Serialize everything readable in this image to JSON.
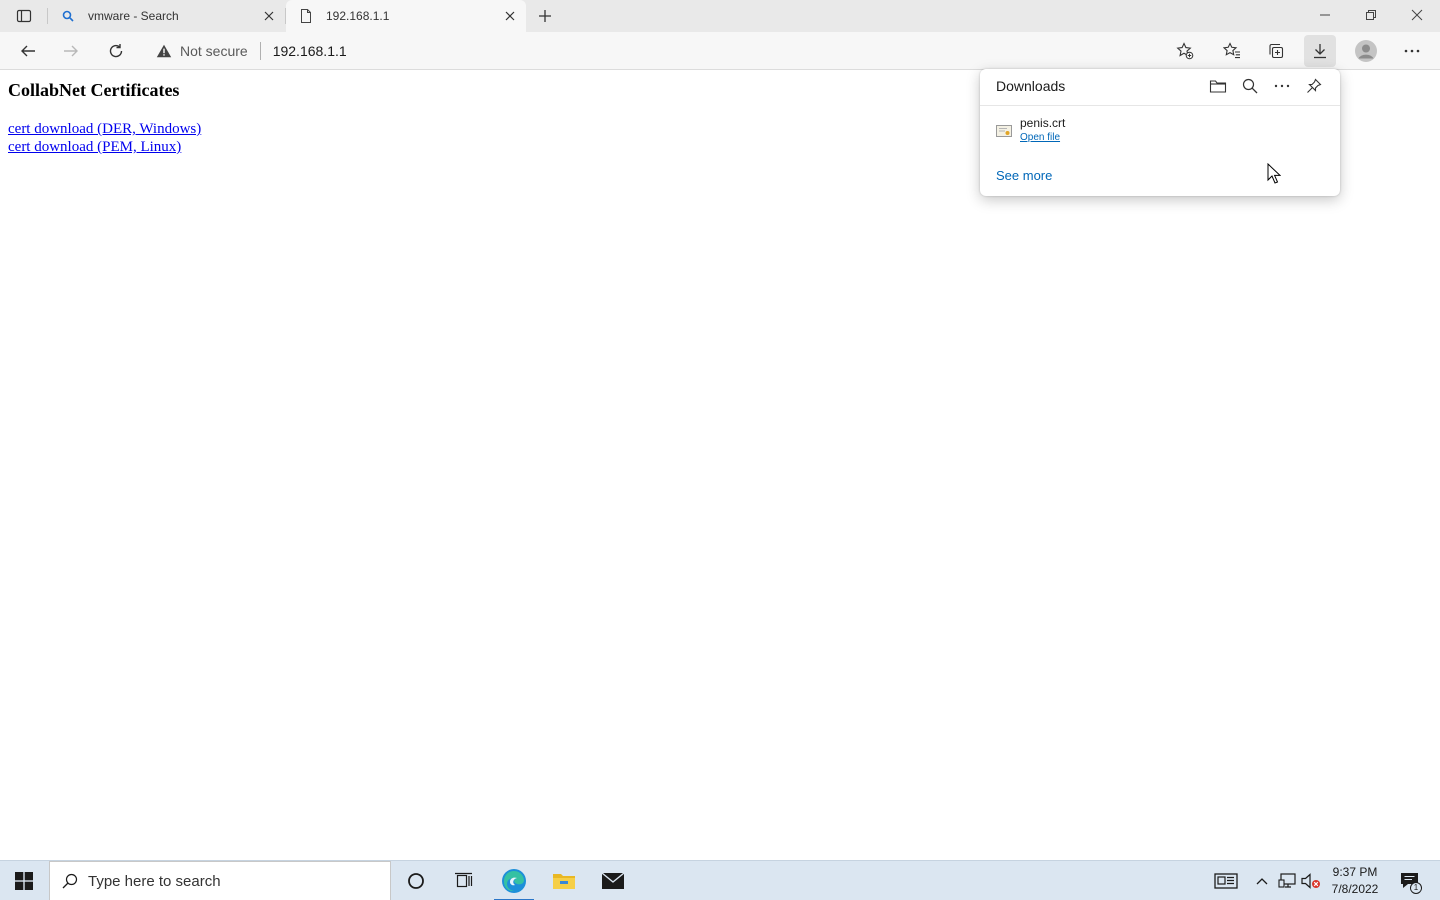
{
  "browser": {
    "tabs": [
      {
        "title": "vmware - Search",
        "icon": "search-icon"
      },
      {
        "title": "192.168.1.1",
        "icon": "page-icon"
      }
    ],
    "address": {
      "security_label": "Not secure",
      "url": "192.168.1.1"
    }
  },
  "page": {
    "heading": "CollabNet Certificates",
    "links": [
      "cert download (DER, Windows)",
      "cert download (PEM, Linux)"
    ]
  },
  "downloads": {
    "title": "Downloads",
    "items": [
      {
        "filename": "penis.crt",
        "action": "Open file"
      }
    ],
    "see_more": "See more"
  },
  "taskbar": {
    "search_placeholder": "Type here to search",
    "clock": {
      "time": "9:37 PM",
      "date": "7/8/2022"
    },
    "notification_count": "1"
  },
  "colors": {
    "link": "#0000ee",
    "accent": "#0067b8",
    "taskbar": "#dbe6f1"
  }
}
